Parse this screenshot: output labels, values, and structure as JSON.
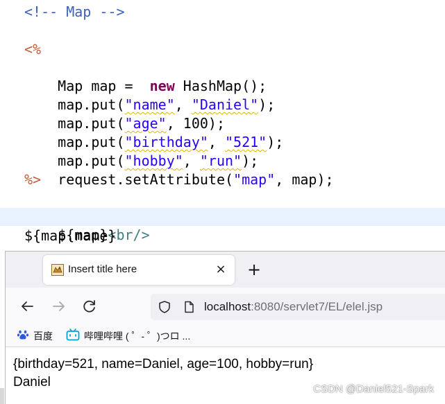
{
  "editor": {
    "lines": {
      "comment": "<!-- Map -->",
      "jsp_open": "<%",
      "l1_a": "Map map =  ",
      "l1_kw": "new",
      "l1_b": " HashMap();",
      "l2_a": "map.put(",
      "l2_s1": "\"name\"",
      "l2_c": ", ",
      "l2_s2": "\"Daniel\"",
      "l2_e": ");",
      "l3_a": "map.put(",
      "l3_s1": "\"age\"",
      "l3_e": ", 100);",
      "l4_a": "map.put(",
      "l4_s1": "\"birthday\"",
      "l4_c": ", ",
      "l4_s2": "\"521\"",
      "l4_e": ");",
      "l5_a": "map.put(",
      "l5_s1": "\"hobby\"",
      "l5_c": ", ",
      "l5_s2": "\"run\"",
      "l5_e": ");",
      "l6_a": "request.setAttribute(",
      "l6_s1": "\"map\"",
      "l6_e": ", map);",
      "jsp_close": "%>",
      "el1_a": "${map}",
      "el1_tag": "<br/>",
      "el2": "${map.name}"
    }
  },
  "browser": {
    "tab_title": "Insert title here",
    "tab_close": "×",
    "new_tab": "+",
    "url_host": "localhost",
    "url_rest": ":8080/servlet7/EL/elel.jsp",
    "bookmarks": [
      {
        "label": "百度",
        "icon": "baidu-paw-icon"
      },
      {
        "label": "哔哩哔哩 ( ゜- ゜)つロ ...",
        "icon": "bilibili-tv-icon"
      }
    ],
    "output": {
      "line1": "{birthday=521, name=Daniel, age=100, hobby=run}",
      "line2": "Daniel"
    }
  },
  "watermark": "CSDN @Daniel521-Spark",
  "colors": {
    "comment": "#3f5fbf",
    "jsp": "#bf5f3f",
    "keyword": "#7f0055",
    "string": "#2a00ff",
    "tag": "#3f7f7f",
    "highlight_line": "#e8f2fe",
    "tabstrip": "#f0f0f4"
  }
}
